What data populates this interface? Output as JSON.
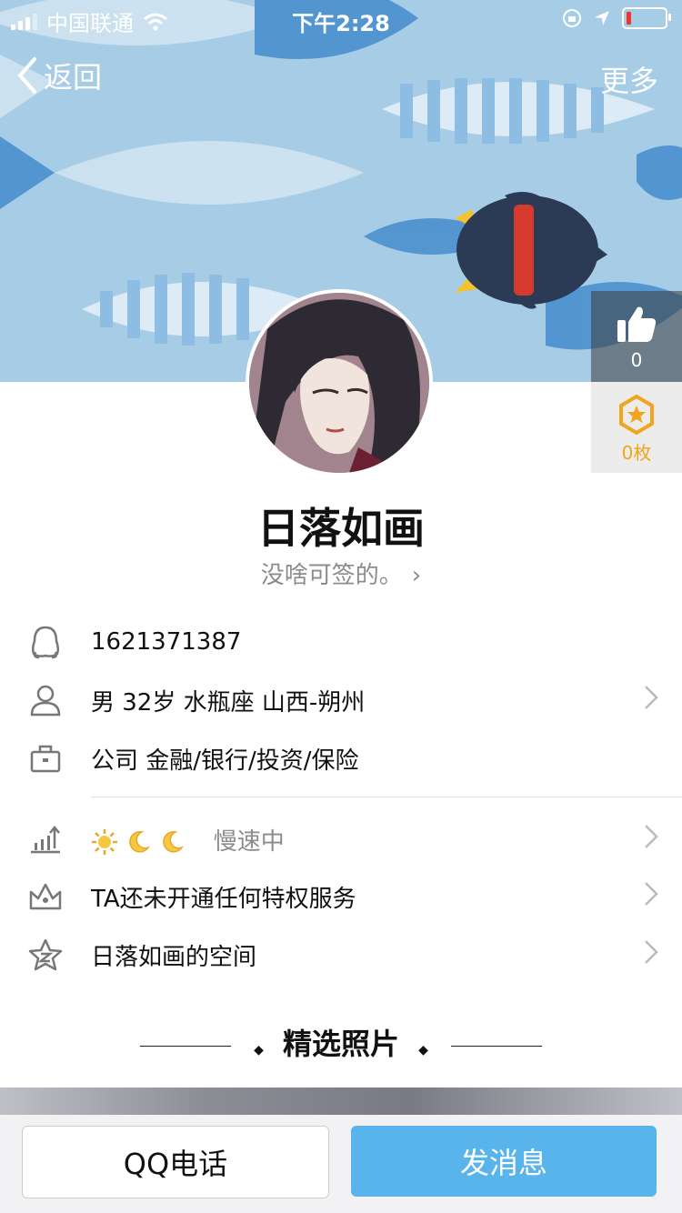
{
  "status_bar": {
    "carrier": "中国联通",
    "time": "下午2:28"
  },
  "nav": {
    "back_label": "返回",
    "more_label": "更多"
  },
  "side": {
    "like_count": "0",
    "medal_count": "0枚"
  },
  "profile": {
    "name": "日落如画",
    "signature": "没啥可签的。",
    "qq_number": "1621371387",
    "basic_info": "男 32岁 水瓶座 山西-朔州",
    "work_info": "公司 金融/银行/投资/保险",
    "level_status": "慢速中",
    "privilege": "TA还未开通任何特权服务",
    "space": "日落如画的空间"
  },
  "section": {
    "title": "精选照片"
  },
  "actions": {
    "call_label": "QQ电话",
    "message_label": "发消息"
  },
  "colors": {
    "accent": "#58b4ea",
    "header_bg": "#a7cde6",
    "medal": "#f0a51c"
  }
}
